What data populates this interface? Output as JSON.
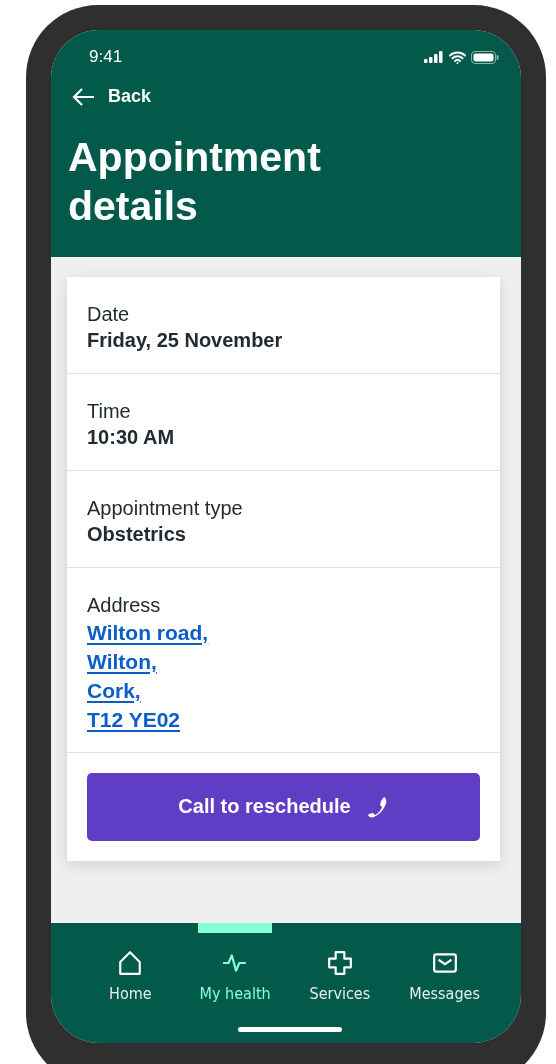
{
  "status_bar": {
    "time": "9:41"
  },
  "header": {
    "back": "Back",
    "title": "Appointment details"
  },
  "details": [
    {
      "kind": "text",
      "label": "Date",
      "value": "Friday, 25 November"
    },
    {
      "kind": "text",
      "label": "Time",
      "value": "10:30 AM"
    },
    {
      "kind": "text",
      "label": "Appointment type",
      "value": "Obstetrics"
    },
    {
      "kind": "address",
      "label": "Address",
      "lines": [
        "Wilton road,",
        "Wilton,",
        "Cork,",
        "T12 YE02"
      ]
    }
  ],
  "action_button": {
    "label": "Call to reschedule"
  },
  "nav": [
    {
      "label": "Home",
      "kind": "home",
      "selected": false
    },
    {
      "label": "My health",
      "kind": "pulse",
      "selected": true
    },
    {
      "label": "Services",
      "kind": "cross",
      "selected": false
    },
    {
      "label": "Messages",
      "kind": "mail",
      "selected": false
    }
  ]
}
